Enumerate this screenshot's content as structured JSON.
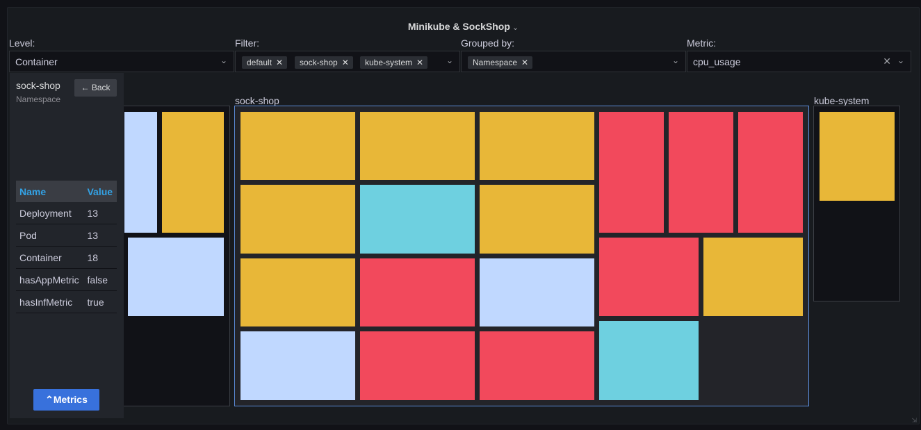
{
  "panel": {
    "title": "Minikube & SockShop"
  },
  "controls": {
    "level": {
      "label": "Level:",
      "value": "Container"
    },
    "filter": {
      "label": "Filter:",
      "chips": [
        "default",
        "sock-shop",
        "kube-system"
      ]
    },
    "grouped_by": {
      "label": "Grouped by:",
      "chips": [
        "Namespace"
      ]
    },
    "metric": {
      "label": "Metric:",
      "value": "cpu_usage"
    }
  },
  "groups": {
    "sock_shop": {
      "title": "sock-shop"
    },
    "kube_system": {
      "title": "kube-system"
    }
  },
  "side_panel": {
    "name": "sock-shop",
    "type": "Namespace",
    "back_label": "Back",
    "table": {
      "headers": [
        "Name",
        "Value"
      ],
      "rows": [
        [
          "Deployment",
          "13"
        ],
        [
          "Pod",
          "13"
        ],
        [
          "Container",
          "18"
        ],
        [
          "hasAppMetric",
          "false"
        ],
        [
          "hasInfMetric",
          "true"
        ]
      ]
    },
    "metrics_label": "Metrics"
  },
  "colors": {
    "yellow": "#e8b738",
    "cyan": "#6ed0e0",
    "red": "#f2495c",
    "lightblue": "#c0d8ff",
    "selection_border": "#5b8bd8",
    "accent_blue": "#3871dc"
  }
}
